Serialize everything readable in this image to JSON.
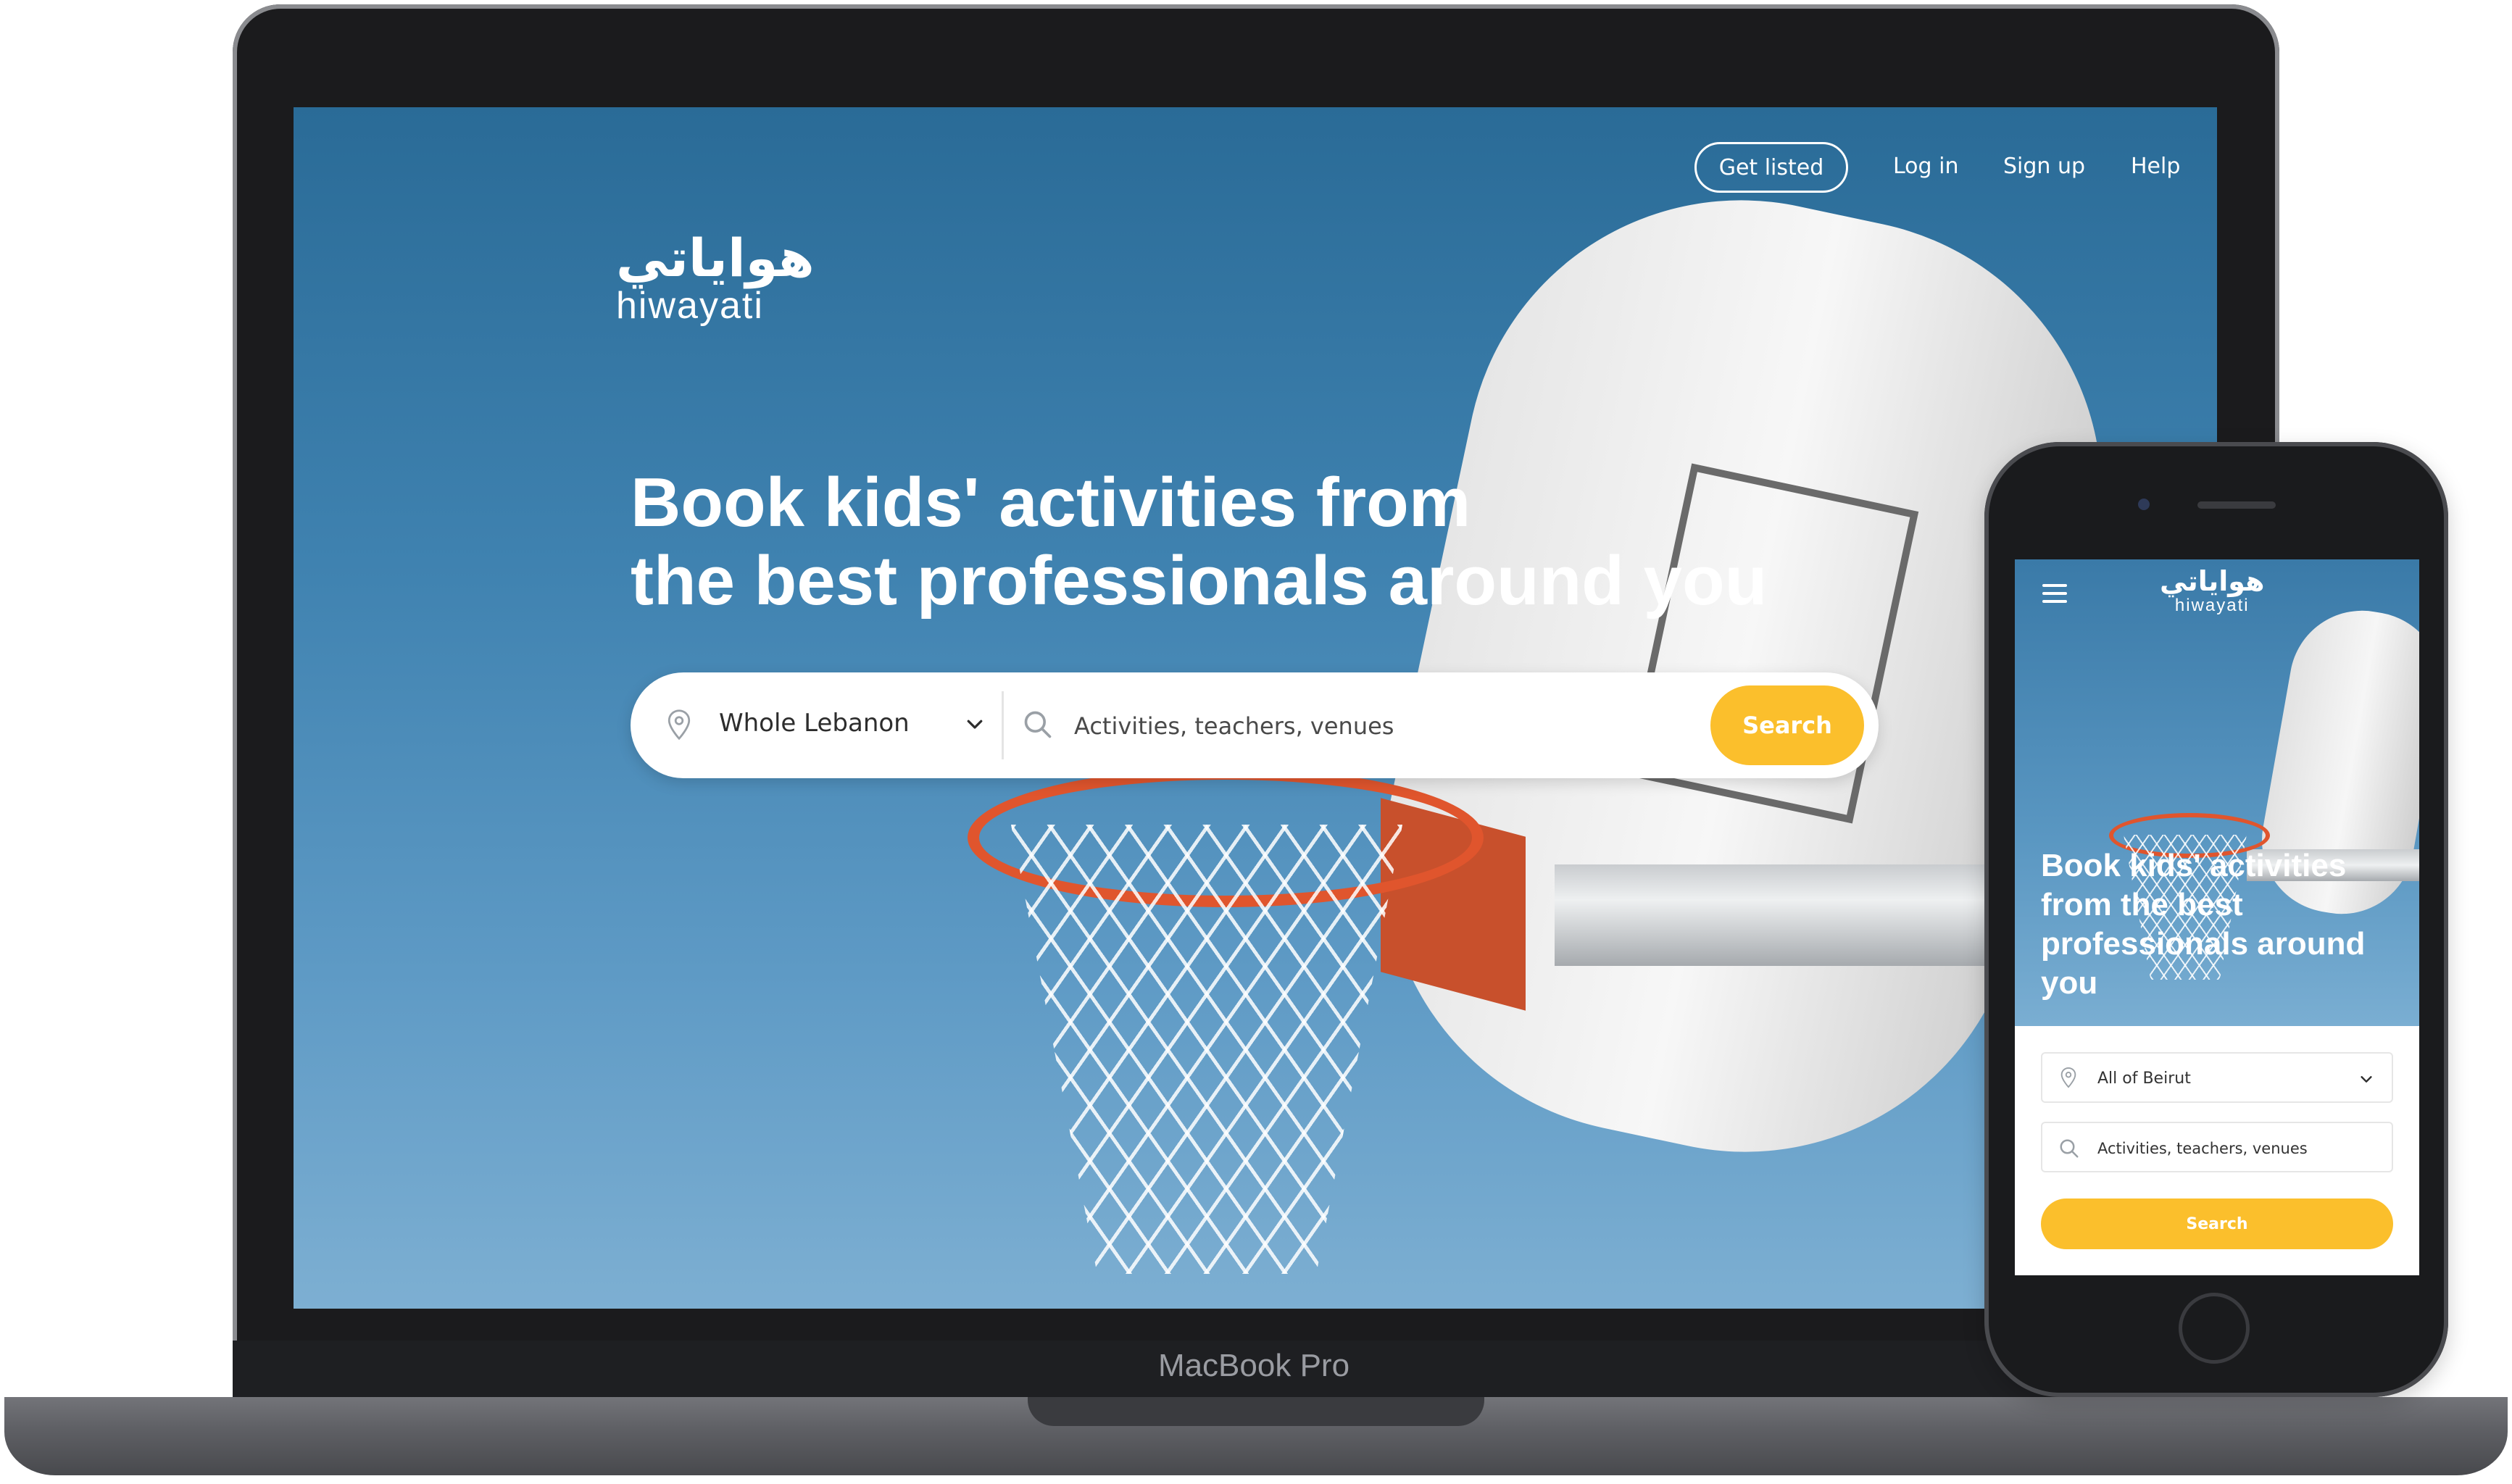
{
  "laptop": {
    "brand_label": "MacBook Pro",
    "logo": {
      "arabic": "هواياتي",
      "latin": "hiwayati"
    },
    "nav": {
      "get_listed": "Get listed",
      "log_in": "Log in",
      "sign_up": "Sign up",
      "help": "Help"
    },
    "hero": {
      "headline_line1": "Book kids' activities from",
      "headline_line2": "the best professionals around you"
    },
    "search": {
      "location_value": "Whole Lebanon",
      "query_placeholder": "Activities, teachers, venues",
      "button_label": "Search"
    }
  },
  "phone": {
    "logo": {
      "arabic": "هواياتي",
      "latin": "hiwayati"
    },
    "hero": {
      "headline": "Book kids' activities from the best professionals around you"
    },
    "search": {
      "location_value": "All of Beirut",
      "query_placeholder": "Activities, teachers, venues",
      "button_label": "Search"
    }
  },
  "theme": {
    "accent": "#fbbf2c",
    "sky": "#3f82b0",
    "rim": "#e0552d"
  }
}
